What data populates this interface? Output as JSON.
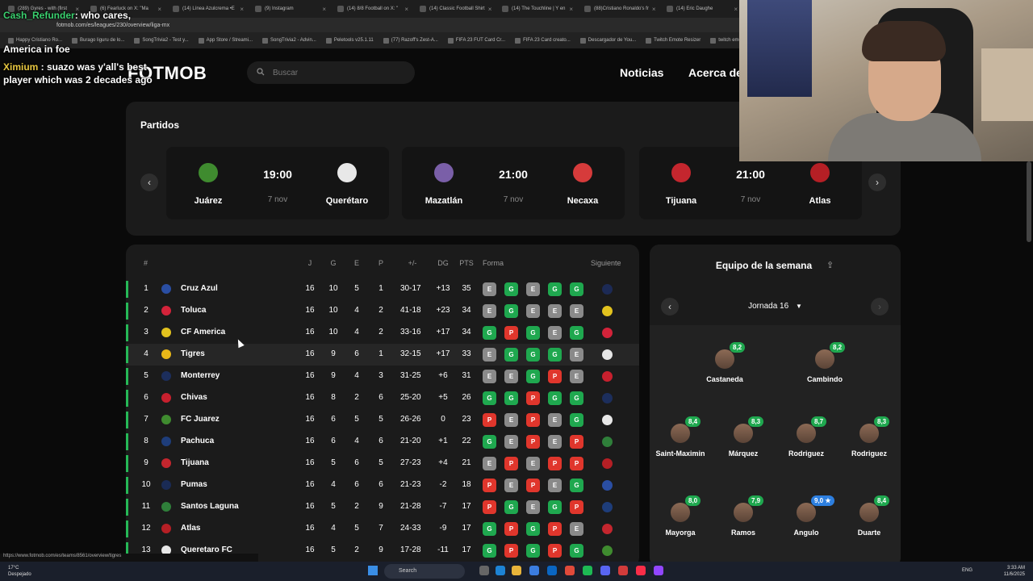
{
  "browser": {
    "tabs": [
      {
        "label": "(289) Gyres - with (first"
      },
      {
        "label": "(6) Fearluck on X: \"Ma"
      },
      {
        "label": "(14) Línea Azulcrema •E"
      },
      {
        "label": "(9) Instagram"
      },
      {
        "label": "(14) 8/8 Football on X: \""
      },
      {
        "label": "(14) Classic Football Shirt"
      },
      {
        "label": "(14) The Touchline | Y en"
      },
      {
        "label": "(88)Cristiano Ronaldo's fr"
      },
      {
        "label": "(14) Eric Daughe"
      }
    ],
    "url": "fotmob.com/es/leagues/230/overview/liga-mx",
    "bookmarks": [
      "Happy Cristiano Ro...",
      "Burago liguru de lo...",
      "SongTrivia2 - Test y...",
      "App Store / Streami...",
      "SongTrivia2 - Advin...",
      "Peletools v25.1.11",
      "(77) Razoff's Zest-A...",
      "FIFA 23 FUT Card Cr...",
      "FIFA 23 Card creato...",
      "Descargador de You...",
      "Twitch Emote Resizer",
      "twitch emote re..."
    ],
    "status_url": "https://www.fotmob.com/es/teams/8561/overview/tigres"
  },
  "chat": {
    "lines": [
      {
        "user": "Cash_Refunder",
        "text": ": who cares,"
      },
      {
        "user": "",
        "text": "America in foe"
      },
      {
        "user": "Ximium",
        "text": " : suazo was y'all's best"
      },
      {
        "user": "",
        "text": "player which was 2 decades ago"
      }
    ]
  },
  "site": {
    "logo": "FOTMOB",
    "search_placeholder": "Buscar",
    "nav": [
      "Noticias",
      "Acerca de"
    ]
  },
  "matches": {
    "title": "Partidos",
    "items": [
      {
        "home": "Juárez",
        "away": "Querétaro",
        "time": "19:00",
        "date": "7 nov",
        "home_color": "#3f8b2f",
        "away_color": "#e8e8e8"
      },
      {
        "home": "Mazatlán",
        "away": "Necaxa",
        "time": "21:00",
        "date": "7 nov",
        "home_color": "#7a5fa8",
        "away_color": "#d63b3b"
      },
      {
        "home": "Tijuana",
        "away": "Atlas",
        "time": "21:00",
        "date": "7 nov",
        "home_color": "#c4262e",
        "away_color": "#b51f25"
      }
    ]
  },
  "table": {
    "headers": {
      "pos": "#",
      "j": "J",
      "g": "G",
      "e": "E",
      "p": "P",
      "diff": "+/-",
      "dg": "DG",
      "pts": "PTS",
      "form": "Forma",
      "next": "Siguiente"
    },
    "rows": [
      {
        "pos": "1",
        "team": "Cruz Azul",
        "j": "16",
        "g": "10",
        "e": "5",
        "p": "1",
        "gf": "30-17",
        "dg": "+13",
        "pts": "35",
        "form": [
          "E",
          "G",
          "E",
          "G",
          "G"
        ],
        "color": "#2a4ea3",
        "next_color": "#1c2a55"
      },
      {
        "pos": "2",
        "team": "Toluca",
        "j": "16",
        "g": "10",
        "e": "4",
        "p": "2",
        "gf": "41-18",
        "dg": "+23",
        "pts": "34",
        "form": [
          "E",
          "G",
          "E",
          "E",
          "E"
        ],
        "color": "#d3233a",
        "next_color": "#e2c21e"
      },
      {
        "pos": "3",
        "team": "CF America",
        "j": "16",
        "g": "10",
        "e": "4",
        "p": "2",
        "gf": "33-16",
        "dg": "+17",
        "pts": "34",
        "form": [
          "G",
          "P",
          "G",
          "E",
          "G"
        ],
        "color": "#e2c21e",
        "next_color": "#d3233a"
      },
      {
        "pos": "4",
        "team": "Tigres",
        "j": "16",
        "g": "9",
        "e": "6",
        "p": "1",
        "gf": "32-15",
        "dg": "+17",
        "pts": "33",
        "form": [
          "E",
          "G",
          "G",
          "G",
          "E"
        ],
        "color": "#e9b718",
        "next_color": "#e6e6e6"
      },
      {
        "pos": "5",
        "team": "Monterrey",
        "j": "16",
        "g": "9",
        "e": "4",
        "p": "3",
        "gf": "31-25",
        "dg": "+6",
        "pts": "31",
        "form": [
          "E",
          "E",
          "G",
          "P",
          "E"
        ],
        "color": "#1c2e5c",
        "next_color": "#c7202e"
      },
      {
        "pos": "6",
        "team": "Chivas",
        "j": "16",
        "g": "8",
        "e": "2",
        "p": "6",
        "gf": "25-20",
        "dg": "+5",
        "pts": "26",
        "form": [
          "G",
          "G",
          "P",
          "G",
          "G"
        ],
        "color": "#c7202e",
        "next_color": "#1c2e5c"
      },
      {
        "pos": "7",
        "team": "FC Juarez",
        "j": "16",
        "g": "6",
        "e": "5",
        "p": "5",
        "gf": "26-26",
        "dg": "0",
        "pts": "23",
        "form": [
          "P",
          "E",
          "P",
          "E",
          "G"
        ],
        "color": "#3f8b2f",
        "next_color": "#e8e8e8"
      },
      {
        "pos": "8",
        "team": "Pachuca",
        "j": "16",
        "g": "6",
        "e": "4",
        "p": "6",
        "gf": "21-20",
        "dg": "+1",
        "pts": "22",
        "form": [
          "G",
          "E",
          "P",
          "E",
          "P"
        ],
        "color": "#1e3d7a",
        "next_color": "#2f7f3a"
      },
      {
        "pos": "9",
        "team": "Tijuana",
        "j": "16",
        "g": "5",
        "e": "6",
        "p": "5",
        "gf": "27-23",
        "dg": "+4",
        "pts": "21",
        "form": [
          "E",
          "P",
          "E",
          "P",
          "P"
        ],
        "color": "#c4262e",
        "next_color": "#b51f25"
      },
      {
        "pos": "10",
        "team": "Pumas",
        "j": "16",
        "g": "4",
        "e": "6",
        "p": "6",
        "gf": "21-23",
        "dg": "-2",
        "pts": "18",
        "form": [
          "P",
          "E",
          "P",
          "E",
          "G"
        ],
        "color": "#1a2b55",
        "next_color": "#2a4ea3"
      },
      {
        "pos": "11",
        "team": "Santos Laguna",
        "j": "16",
        "g": "5",
        "e": "2",
        "p": "9",
        "gf": "21-28",
        "dg": "-7",
        "pts": "17",
        "form": [
          "P",
          "G",
          "E",
          "G",
          "P"
        ],
        "color": "#2f7f3a",
        "next_color": "#1e3d7a"
      },
      {
        "pos": "12",
        "team": "Atlas",
        "j": "16",
        "g": "4",
        "e": "5",
        "p": "7",
        "gf": "24-33",
        "dg": "-9",
        "pts": "17",
        "form": [
          "G",
          "P",
          "G",
          "P",
          "E"
        ],
        "color": "#b51f25",
        "next_color": "#c4262e"
      },
      {
        "pos": "13",
        "team": "Queretaro FC",
        "j": "16",
        "g": "5",
        "e": "2",
        "p": "9",
        "gf": "17-28",
        "dg": "-11",
        "pts": "17",
        "form": [
          "G",
          "P",
          "G",
          "P",
          "G"
        ],
        "color": "#e8e8e8",
        "next_color": "#3f8b2f"
      }
    ]
  },
  "totw": {
    "title": "Equipo de la semana",
    "round": "Jornada 16",
    "players": [
      {
        "name": "Castaneda",
        "rating": "8,2",
        "star": false
      },
      {
        "name": "Cambindo",
        "rating": "8,2",
        "star": false
      },
      {
        "name": "Saint-Maximin",
        "rating": "8,4",
        "star": false
      },
      {
        "name": "Márquez",
        "rating": "8,3",
        "star": false
      },
      {
        "name": "Rodriguez",
        "rating": "8,7",
        "star": false
      },
      {
        "name": "Rodriguez",
        "rating": "8,3",
        "star": false
      },
      {
        "name": "Mayorga",
        "rating": "8,0",
        "star": false
      },
      {
        "name": "Ramos",
        "rating": "7,9",
        "star": false
      },
      {
        "name": "Angulo",
        "rating": "9,0 ★",
        "star": true
      },
      {
        "name": "Duarte",
        "rating": "8,4",
        "star": false
      }
    ]
  },
  "taskbar": {
    "weather_temp": "17°C",
    "weather_desc": "Despejado",
    "search": "Search",
    "lang": "ENG",
    "time": "3:33 AM",
    "date": "11/6/2025"
  }
}
